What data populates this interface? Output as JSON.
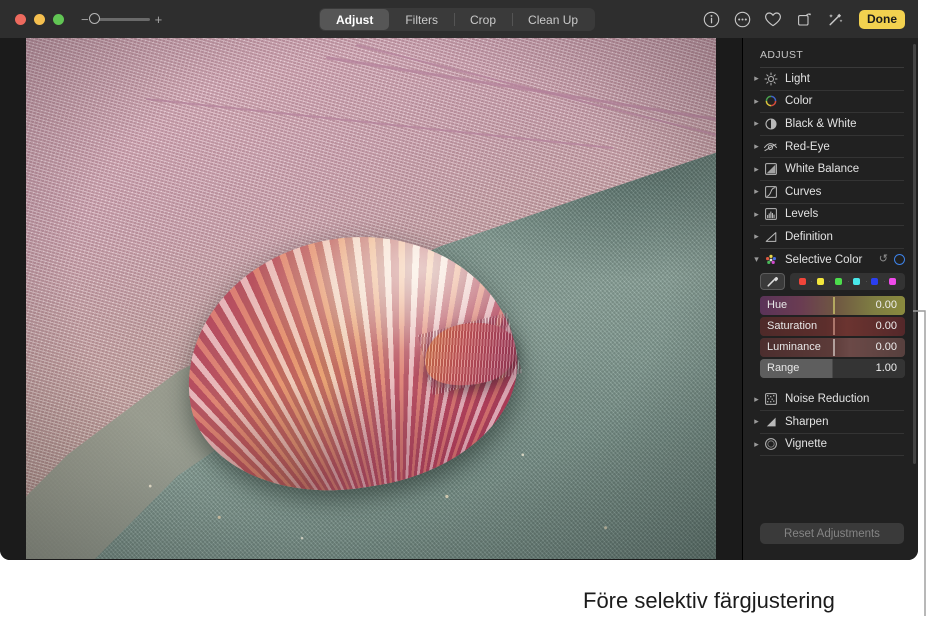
{
  "window": {
    "traffic_lights": [
      "close",
      "minimize",
      "zoom"
    ],
    "zoom_minus": "−",
    "zoom_plus": "+",
    "tabs": [
      {
        "label": "Adjust",
        "active": true
      },
      {
        "label": "Filters",
        "active": false
      },
      {
        "label": "Crop",
        "active": false
      },
      {
        "label": "Clean Up",
        "active": false
      }
    ],
    "toolbar_icons": [
      "info-icon",
      "more-options-icon",
      "favorite-heart-icon",
      "rotate-icon",
      "auto-enhance-icon"
    ],
    "done_label": "Done"
  },
  "sidebar": {
    "title": "ADJUST",
    "items": [
      {
        "label": "Light",
        "icon": "light-icon",
        "expanded": false
      },
      {
        "label": "Color",
        "icon": "color-wheel-icon",
        "expanded": false
      },
      {
        "label": "Black & White",
        "icon": "black-white-icon",
        "expanded": false
      },
      {
        "label": "Red-Eye",
        "icon": "red-eye-icon",
        "expanded": false
      },
      {
        "label": "White Balance",
        "icon": "white-balance-icon",
        "expanded": false
      },
      {
        "label": "Curves",
        "icon": "curves-icon",
        "expanded": false
      },
      {
        "label": "Levels",
        "icon": "levels-icon",
        "expanded": false
      },
      {
        "label": "Definition",
        "icon": "definition-icon",
        "expanded": false
      },
      {
        "label": "Selective Color",
        "icon": "selective-color-icon",
        "expanded": true
      }
    ],
    "items_after": [
      {
        "label": "Noise Reduction",
        "icon": "noise-reduction-icon",
        "expanded": false
      },
      {
        "label": "Sharpen",
        "icon": "sharpen-icon",
        "expanded": false
      },
      {
        "label": "Vignette",
        "icon": "vignette-icon",
        "expanded": false
      }
    ],
    "selective_color": {
      "revert_icon": "↺",
      "toggle_icon": "on-off-ring-icon",
      "eyedropper_icon": "eyedropper-icon",
      "swatches": [
        {
          "name": "red",
          "color": "#f0453a"
        },
        {
          "name": "yellow",
          "color": "#f2e63c"
        },
        {
          "name": "green",
          "color": "#4cdd4c"
        },
        {
          "name": "cyan",
          "color": "#49e8ea"
        },
        {
          "name": "blue",
          "color": "#2b3ff0"
        },
        {
          "name": "magenta",
          "color": "#ef4aea"
        }
      ],
      "sliders": [
        {
          "label": "Hue",
          "value": "0.00",
          "knob_pct": 50,
          "gradient": "linear-gradient(90deg, #5a3358 0%, #6a3c52 28%, #6f5742 52%, #7e7d42 78%, #8a8a3e 100%)"
        },
        {
          "label": "Saturation",
          "value": "0.00",
          "knob_pct": 50,
          "gradient": "linear-gradient(90deg, #4e2a29 0%, #5c2e2c 45%, #6b3430 60%, #54282a 100%)"
        },
        {
          "label": "Luminance",
          "value": "0.00",
          "knob_pct": 50,
          "gradient": "linear-gradient(90deg, #4c2e2e 0%, #5b3a38 48%, #6b4947 62%, #57403e 100%)"
        },
        {
          "label": "Range",
          "value": "1.00",
          "knob_pct": 50,
          "gradient": "linear-gradient(90deg, #5e5e5e 0%, #5e5e5e 50%, #343434 50%, #343434 100%)"
        }
      ]
    },
    "reset_label": "Reset Adjustments"
  },
  "caption": {
    "text": "Före selektiv färgjustering",
    "callout_target": "Hue slider"
  },
  "colors": {
    "accent": "#f2d14f",
    "toggle_blue": "#3d82e8",
    "panel_bg": "#212121",
    "titlebar_bg": "#2e2e2e",
    "canvas_bg": "#1b1b1b"
  }
}
